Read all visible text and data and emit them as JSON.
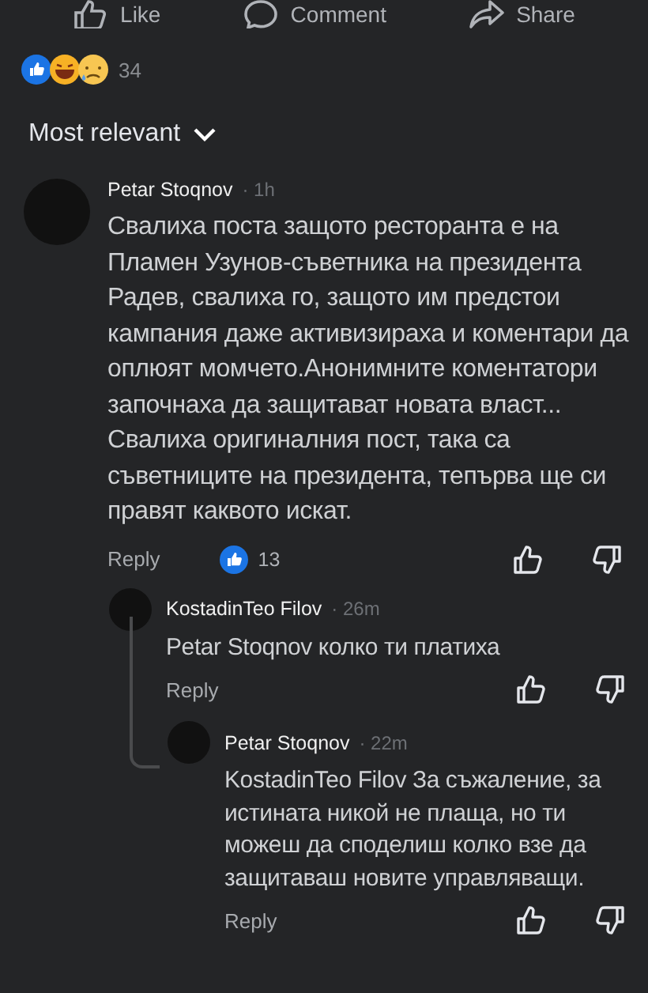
{
  "action_bar": [
    {
      "label": "Like"
    },
    {
      "label": "Comment"
    },
    {
      "label": "Share"
    }
  ],
  "reactions": {
    "count": "34"
  },
  "sort": {
    "label": "Most relevant"
  },
  "comments": [
    {
      "author": "Petar Stoqnov",
      "time": "· 1h",
      "text": "Свалиха поста защото ресторанта е на Пламен Узунов-съветника на президента Радев, свалиха го, защото им предстои кампания даже активизираха и коментари да оплюят момчето.Анонимните коментатори започнаха да защитават новата власт...\nСвалиха оригиналния пост, така са съветниците на президента, тепърва ще си правят каквото искат.",
      "reply_label": "Reply",
      "likes": "13",
      "children": [
        {
          "author": "KostadinTeo Filov",
          "time": "· 26m",
          "text": "Petar Stoqnov колко ти платиха",
          "reply_label": "Reply",
          "children": [
            {
              "author": "Petar Stoqnov",
              "time": "· 22m",
              "text": "KostadinTeo Filov За съжаление, за истината никой не плаща, но ти можеш да споделиш колко взе да защитаваш новите управляващи.",
              "reply_label": "Reply"
            }
          ]
        }
      ]
    }
  ]
}
